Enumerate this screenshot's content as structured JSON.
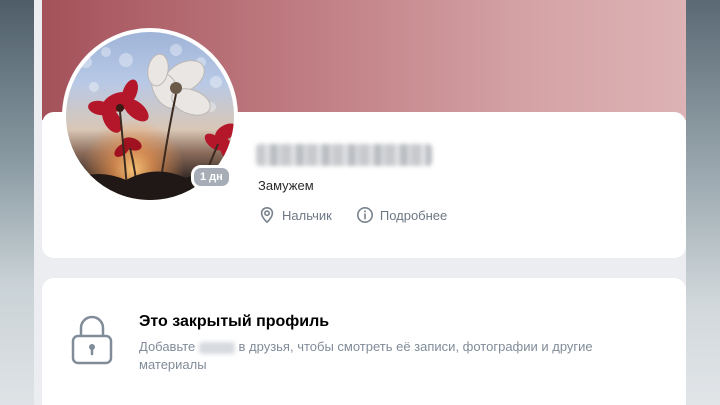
{
  "profile": {
    "online_badge": "1 дн",
    "status": "Замужем",
    "location": "Нальчик",
    "more_label": "Подробнее"
  },
  "closed_profile": {
    "title": "Это закрытый профиль",
    "text_before": "Добавьте",
    "text_after": "в друзья, чтобы смотреть её записи, фотографии и другие материалы"
  },
  "icons": {
    "location": "location-pin-icon",
    "info": "info-icon",
    "lock": "lock-icon"
  },
  "colors": {
    "cover_start": "#a4515a",
    "cover_end": "#ddb3b5",
    "muted_text": "#818c99",
    "secondary_text": "#6d7885"
  }
}
